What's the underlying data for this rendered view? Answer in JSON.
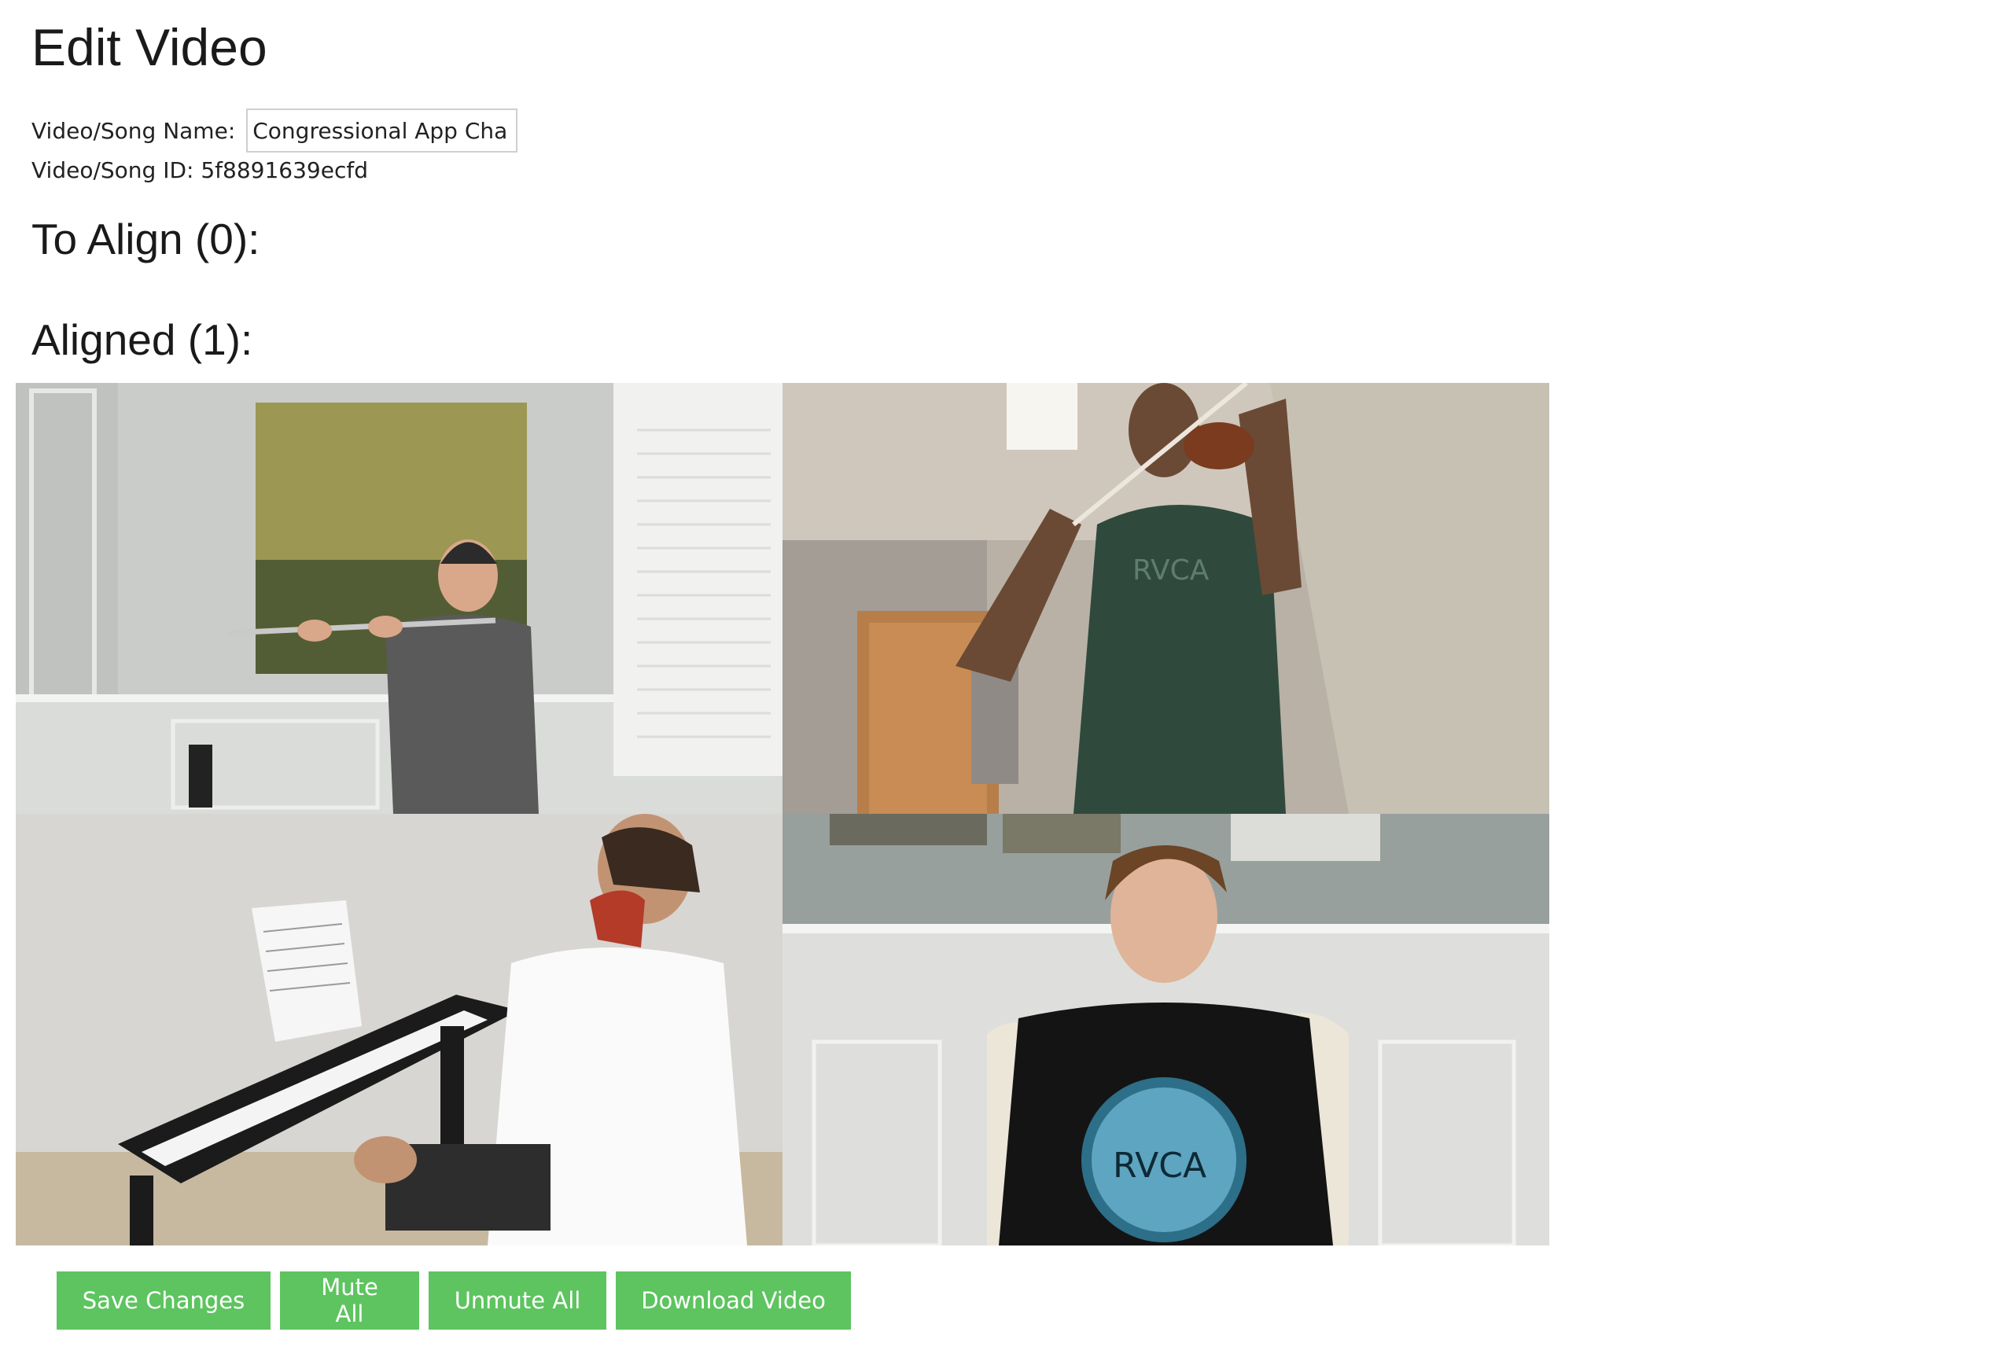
{
  "page": {
    "title": "Edit Video"
  },
  "form": {
    "name_label": "Video/Song Name:",
    "name_value": "Congressional App Cha",
    "id_text": "Video/Song ID: 5f8891639ecfd"
  },
  "sections": {
    "to_align": "To Align (0):",
    "aligned": "Aligned (1):"
  },
  "videos": {
    "tiles": [
      {
        "instrument": "flute"
      },
      {
        "instrument": "violin",
        "shirt_text": "RVCA"
      },
      {
        "instrument": "piano"
      },
      {
        "instrument": "vocal",
        "shirt_text": "RVCA"
      }
    ]
  },
  "toolbar": {
    "save_label": "Save Changes",
    "mute_label": "Mute All",
    "unmute_label": "Unmute All",
    "download_label": "Download Video"
  },
  "colors": {
    "button_green": "#5dc45f",
    "button_text": "#ffffff"
  }
}
